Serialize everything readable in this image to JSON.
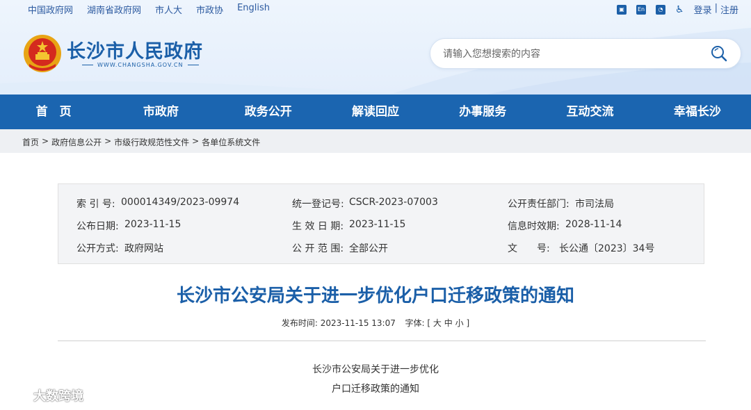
{
  "top_links": [
    "中国政府网",
    "湖南省政府网",
    "市人大",
    "市政协",
    "English"
  ],
  "top_right": {
    "icon_en": "En",
    "login": "登录",
    "sep": "|",
    "register": "注册"
  },
  "brand": {
    "name": "长沙市人民政府",
    "domain": "WWW.CHANGSHA.GOV.CN"
  },
  "search": {
    "placeholder": "请输入您想搜索的内容"
  },
  "nav": [
    "首　页",
    "市政府",
    "政务公开",
    "解读回应",
    "办事服务",
    "互动交流",
    "幸福长沙"
  ],
  "breadcrumb": [
    "首页",
    ">",
    "政府信息公开",
    ">",
    "市级行政规范性文件",
    ">",
    "各单位系统文件"
  ],
  "meta": {
    "index_label": "索 引 号:",
    "index_value": "000014349/2023-09974",
    "reg_label": "统一登记号:",
    "reg_value": "CSCR-2023-07003",
    "dept_label": "公开责任部门:",
    "dept_value": "市司法局",
    "pub_label": "公布日期:",
    "pub_value": "2023-11-15",
    "eff_label": "生 效 日 期:",
    "eff_value": "2023-11-15",
    "valid_label": "信息时效期:",
    "valid_value": "2028-11-14",
    "mode_label": "公开方式:",
    "mode_value": "政府网站",
    "scope_label": "公 开 范 围:",
    "scope_value": "全部公开",
    "doc_label": "文　　号:",
    "doc_value": "长公通〔2023〕34号"
  },
  "article": {
    "title": "长沙市公安局关于进一步优化户口迁移政策的通知",
    "time_label": "发布时间:",
    "time_value": "2023-11-15 13:07",
    "font_label": "字体:",
    "font_open": "[",
    "font_large": "大",
    "font_medium": "中",
    "font_small": "小",
    "font_close": "]",
    "body_line1": "长沙市公安局关于进一步优化",
    "body_line2": "户口迁移政策的通知"
  },
  "watermark": "大数跨境"
}
